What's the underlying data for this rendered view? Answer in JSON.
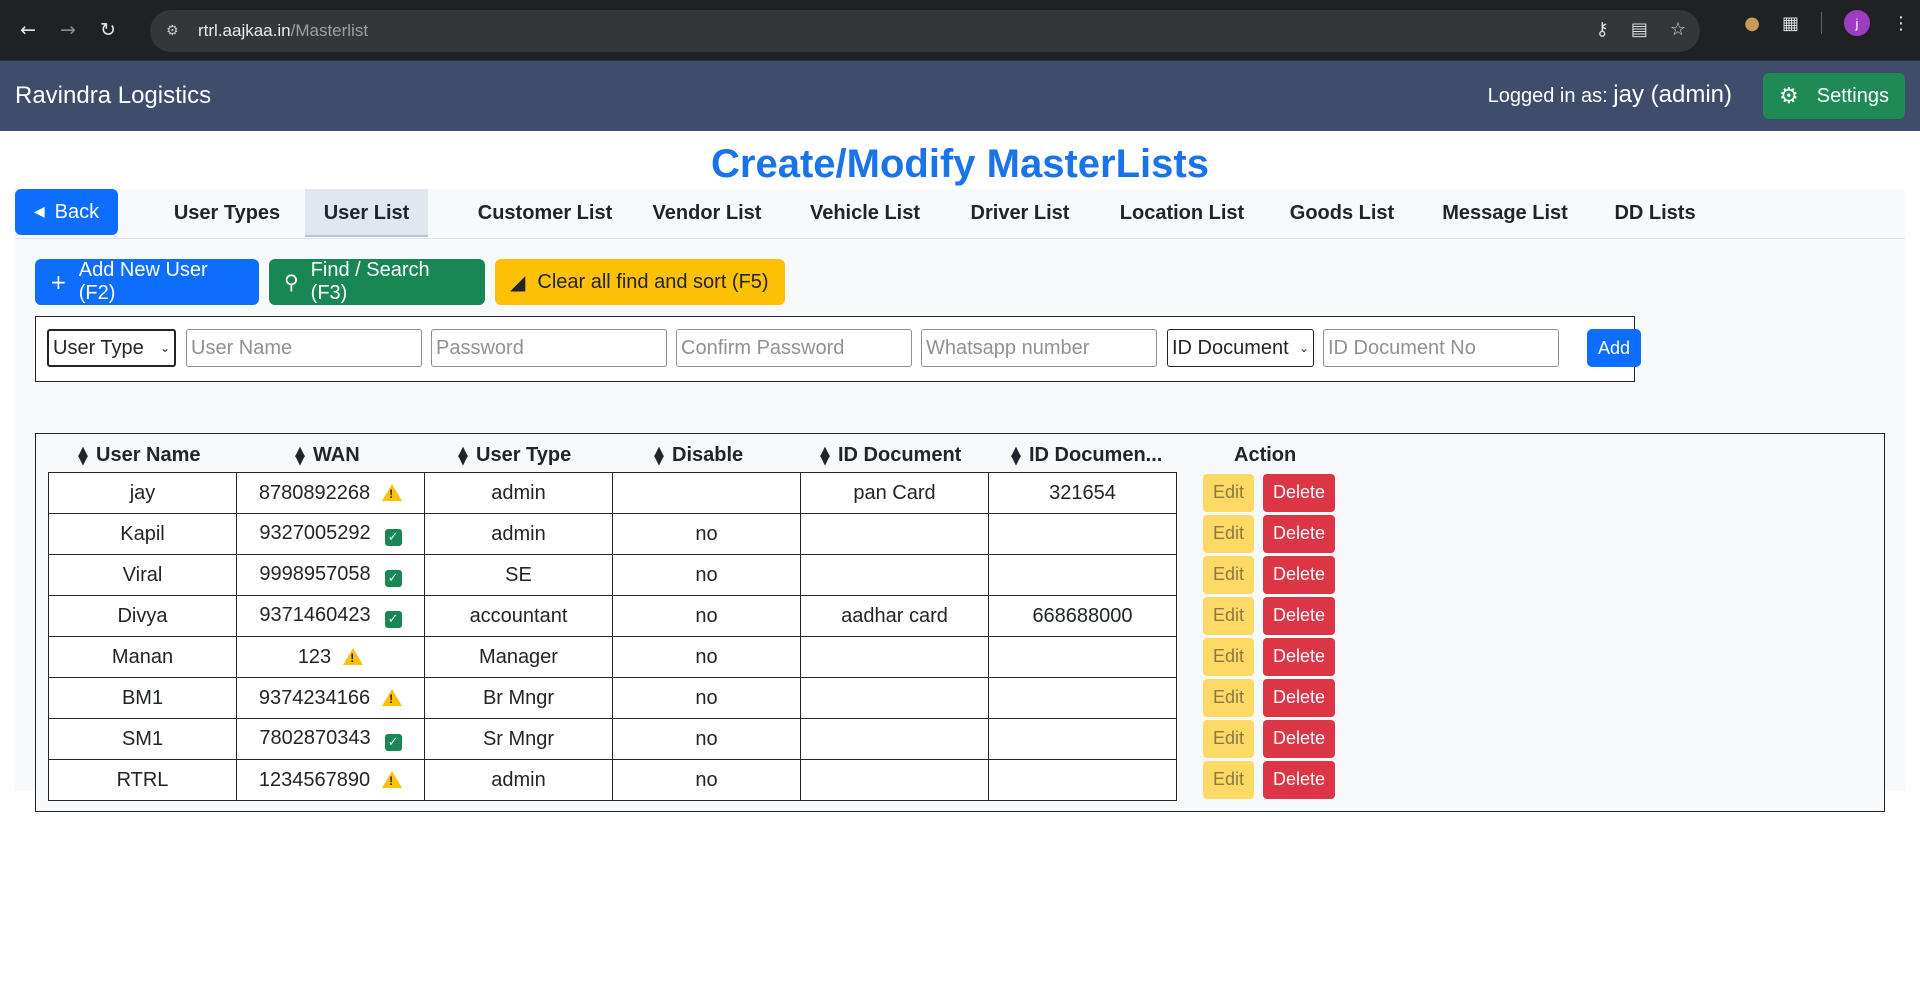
{
  "browser": {
    "url_host": "rtrl.aajkaa.in",
    "url_path": "/Masterlist",
    "profile_initial": "j"
  },
  "app": {
    "brand": "Ravindra Logistics",
    "logged_prefix": "Logged in as:",
    "logged_user": "jay (admin)",
    "settings_label": "Settings"
  },
  "page": {
    "title": "Create/Modify MasterLists",
    "back_label": "Back",
    "tabs": [
      "User Types",
      "User List",
      "Customer List",
      "Vendor List",
      "Vehicle List",
      "Driver List",
      "Location List",
      "Goods List",
      "Message List",
      "DD Lists"
    ],
    "active_tab": "User List"
  },
  "toolbar": {
    "add_label": "Add New User (F2)",
    "find_label": "Find / Search (F3)",
    "clear_label": "Clear all find and sort (F5)"
  },
  "form": {
    "user_type": "User Type",
    "user_name_placeholder": "User Name",
    "password_placeholder": "Password",
    "confirm_placeholder": "Confirm Password",
    "whatsapp_placeholder": "Whatsapp number",
    "id_document": "ID Document",
    "id_doc_no_placeholder": "ID Document No",
    "add_label": "Add"
  },
  "table": {
    "headers": [
      "User Name",
      "WAN",
      "User Type",
      "Disable",
      "ID Document",
      "ID Documen...",
      "Action"
    ],
    "edit_label": "Edit",
    "delete_label": "Delete",
    "rows": [
      {
        "name": "jay",
        "wan": "8780892268",
        "wan_status": "warning",
        "type": "admin",
        "disable": "",
        "id_doc": "pan Card",
        "id_no": "321654"
      },
      {
        "name": "Kapil",
        "wan": "9327005292",
        "wan_status": "verified",
        "type": "admin",
        "disable": "no",
        "id_doc": "",
        "id_no": ""
      },
      {
        "name": "Viral",
        "wan": "9998957058",
        "wan_status": "verified",
        "type": "SE",
        "disable": "no",
        "id_doc": "",
        "id_no": ""
      },
      {
        "name": "Divya",
        "wan": "9371460423",
        "wan_status": "verified",
        "type": "accountant",
        "disable": "no",
        "id_doc": "aadhar card",
        "id_no": "668688000"
      },
      {
        "name": "Manan",
        "wan": "123",
        "wan_status": "warning",
        "type": "Manager",
        "disable": "no",
        "id_doc": "",
        "id_no": ""
      },
      {
        "name": "BM1",
        "wan": "9374234166",
        "wan_status": "warning",
        "type": "Br Mngr",
        "disable": "no",
        "id_doc": "",
        "id_no": ""
      },
      {
        "name": "SM1",
        "wan": "7802870343",
        "wan_status": "verified",
        "type": "Sr Mngr",
        "disable": "no",
        "id_doc": "",
        "id_no": ""
      },
      {
        "name": "RTRL",
        "wan": "1234567890",
        "wan_status": "warning",
        "type": "admin",
        "disable": "no",
        "id_doc": "",
        "id_no": ""
      }
    ]
  },
  "colors": {
    "brand_bar": "#3f4c6b",
    "title_blue": "#1a73e8",
    "primary": "#0d6efd",
    "success": "#198754",
    "warning": "#ffc107",
    "danger": "#dc3545"
  }
}
